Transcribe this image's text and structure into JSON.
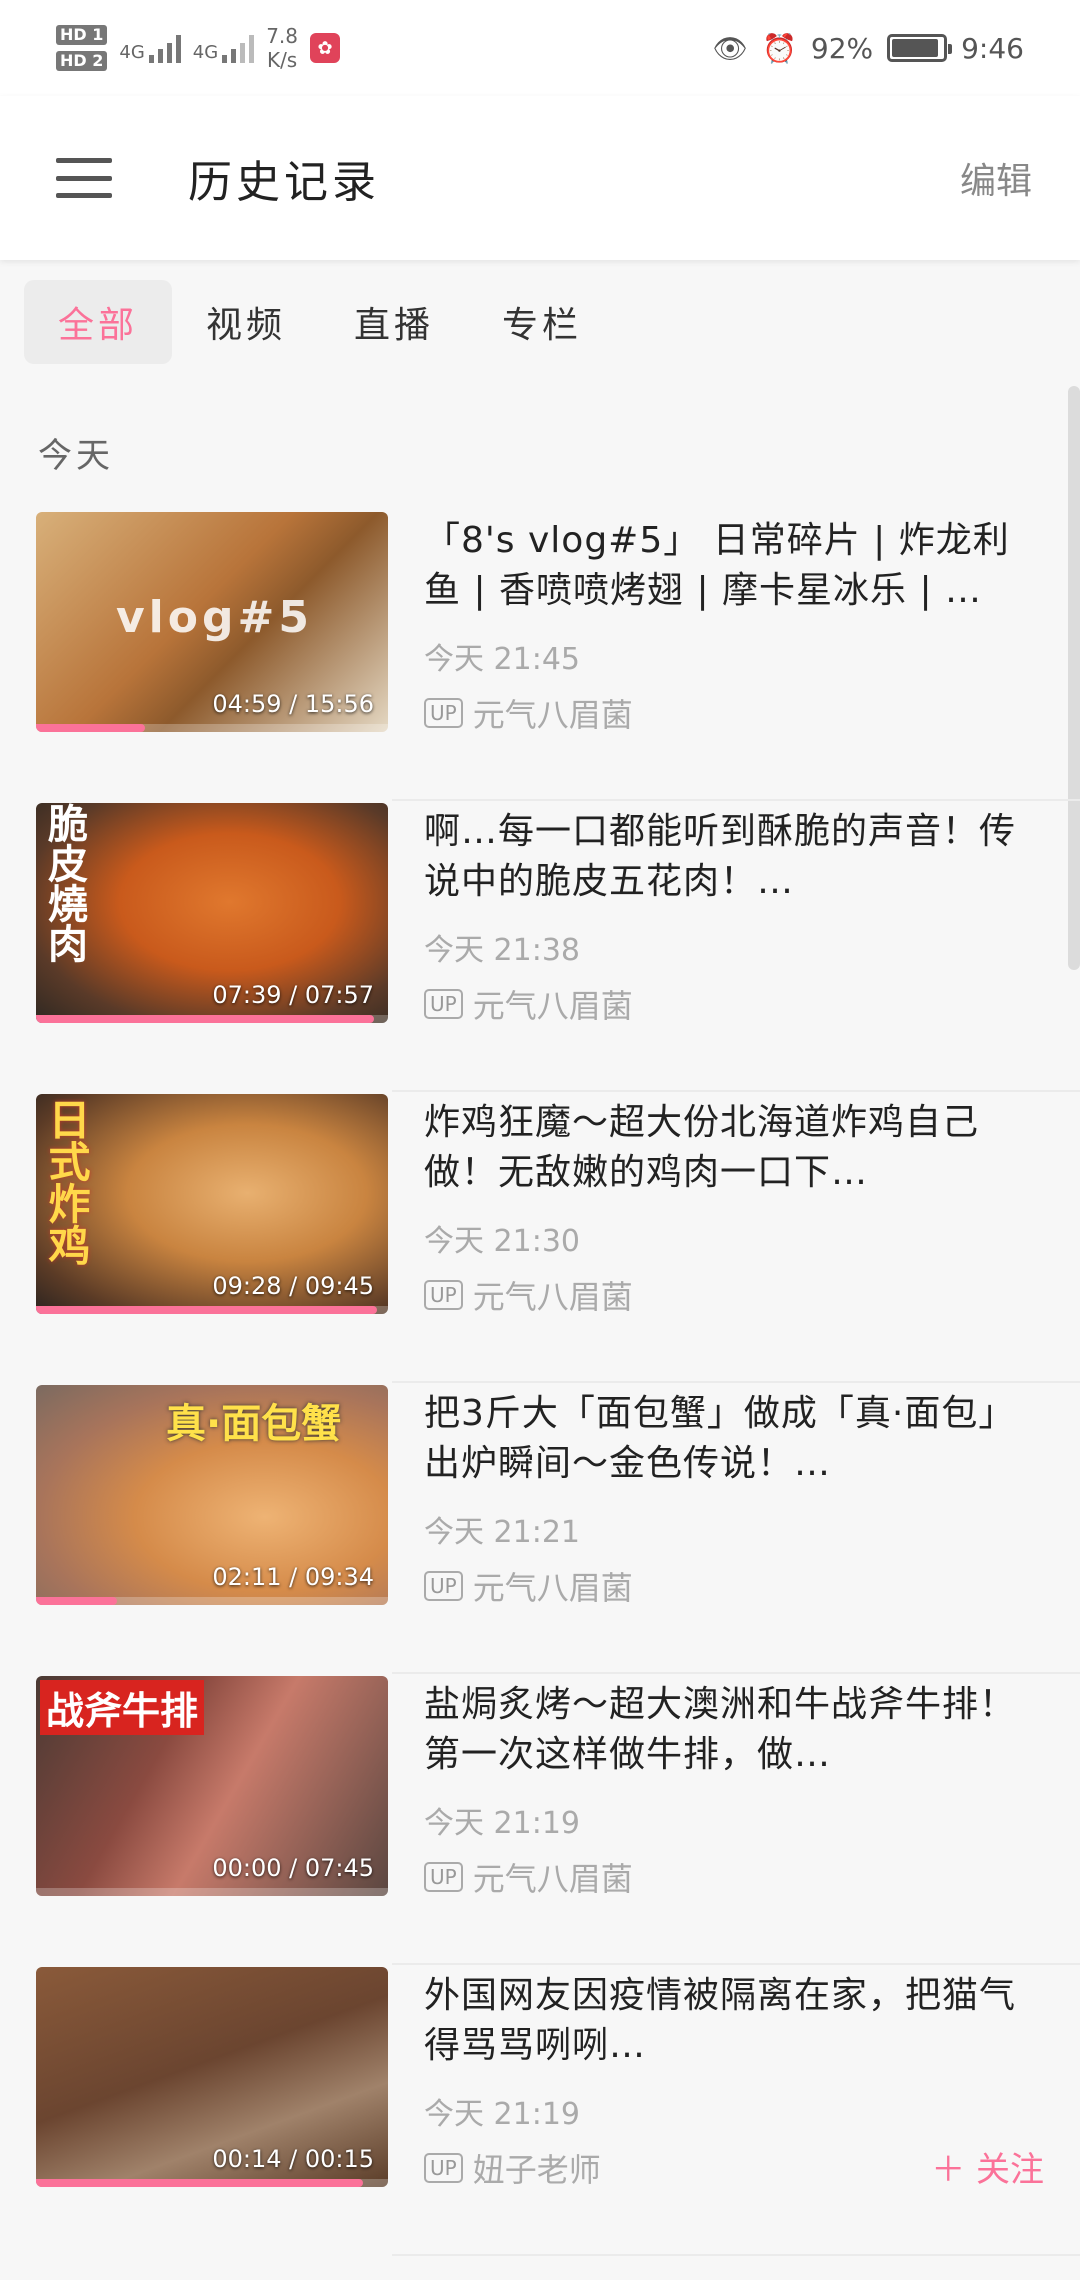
{
  "status_bar": {
    "hd1": "HD 1",
    "hd2": "HD 2",
    "net1": "4G",
    "net2": "4G",
    "speed_value": "7.8",
    "speed_unit": "K/s",
    "battery": "92%",
    "time": "9:46"
  },
  "header": {
    "title": "历史记录",
    "edit_label": "编辑"
  },
  "tabs": [
    {
      "label": "全部",
      "active": true
    },
    {
      "label": "视频",
      "active": false
    },
    {
      "label": "直播",
      "active": false
    },
    {
      "label": "专栏",
      "active": false
    }
  ],
  "section": {
    "label": "今天"
  },
  "items": [
    {
      "title": "「8's vlog#5」 日常碎片 | 炸龙利鱼 | 香喷喷烤翅 | 摩卡星冰乐 | …",
      "time": "今天 21:45",
      "up_badge": "UP",
      "uploader": "元气八眉菌",
      "duration": "04:59 / 15:56",
      "progress": 0.31,
      "thumb_text": "vlog#5"
    },
    {
      "title": "啊…每一口都能听到酥脆的声音！传说中的脆皮五花肉！…",
      "time": "今天 21:38",
      "up_badge": "UP",
      "uploader": "元气八眉菌",
      "duration": "07:39 / 07:57",
      "progress": 0.96,
      "thumb_text": "脆皮燒肉"
    },
    {
      "title": "炸鸡狂魔～超大份北海道炸鸡自己做！无敌嫩的鸡肉一口下…",
      "time": "今天 21:30",
      "up_badge": "UP",
      "uploader": "元气八眉菌",
      "duration": "09:28 / 09:45",
      "progress": 0.97,
      "thumb_text": "日式炸鸡"
    },
    {
      "title": "把3斤大「面包蟹」做成「真·面包」出炉瞬间～金色传说！…",
      "time": "今天 21:21",
      "up_badge": "UP",
      "uploader": "元气八眉菌",
      "duration": "02:11 / 09:34",
      "progress": 0.23,
      "thumb_text": "真·面包蟹"
    },
    {
      "title": "盐焗炙烤～超大澳洲和牛战斧牛排！第一次这样做牛排，做…",
      "time": "今天 21:19",
      "up_badge": "UP",
      "uploader": "元气八眉菌",
      "duration": "00:00 / 07:45",
      "progress": 0.0,
      "thumb_text": "战斧牛排"
    },
    {
      "title": "外国网友因疫情被隔离在家，把猫气得骂骂咧咧…",
      "time": "今天 21:19",
      "up_badge": "UP",
      "uploader": "妞子老师",
      "duration": "00:14 / 00:15",
      "progress": 0.93,
      "thumb_text": "",
      "follow_label": "＋ 关注"
    }
  ],
  "colors": {
    "accent": "#fb7299"
  }
}
